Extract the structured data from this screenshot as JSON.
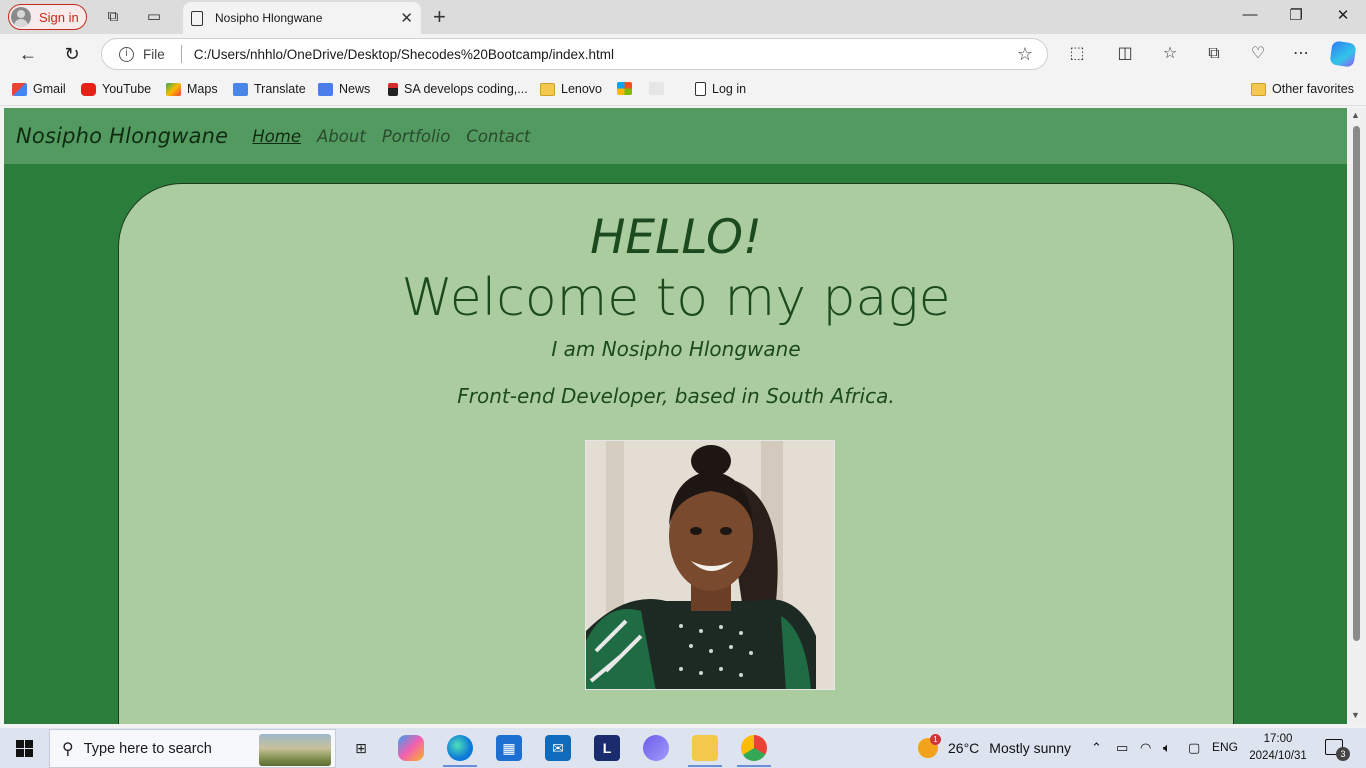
{
  "browser": {
    "signin_label": "Sign in",
    "tab_title": "Nosipho Hlongwane",
    "url_scheme": "File",
    "url": "C:/Users/nhhlo/OneDrive/Desktop/Shecodes%20Bootcamp/index.html"
  },
  "bookmarks": {
    "items": [
      "Gmail",
      "YouTube",
      "Maps",
      "Translate",
      "News",
      "SA develops coding,...",
      "Lenovo",
      "",
      "",
      "Log in"
    ],
    "other": "Other favorites"
  },
  "site": {
    "brand": "Nosipho Hlongwane",
    "nav": [
      "Home",
      "About",
      "Portfolio",
      "Contact"
    ],
    "active_nav": "Home",
    "hello": "HELLO!",
    "welcome": "Welcome to my page",
    "intro": "I am Nosipho Hlongwane",
    "role": "Front-end Developer, based in South Africa."
  },
  "taskbar": {
    "search_placeholder": "Type here to search",
    "weather_temp": "26°C",
    "weather_desc": "Mostly sunny",
    "weather_badge": "1",
    "language": "ENG",
    "time": "17:00",
    "date": "2024/10/31",
    "notifications": "3"
  },
  "colors": {
    "page_bg": "#2a7d3a",
    "nav_bg": "#539a61",
    "card_bg": "#abcc9f",
    "text_dark_green": "#1c4a1f"
  }
}
